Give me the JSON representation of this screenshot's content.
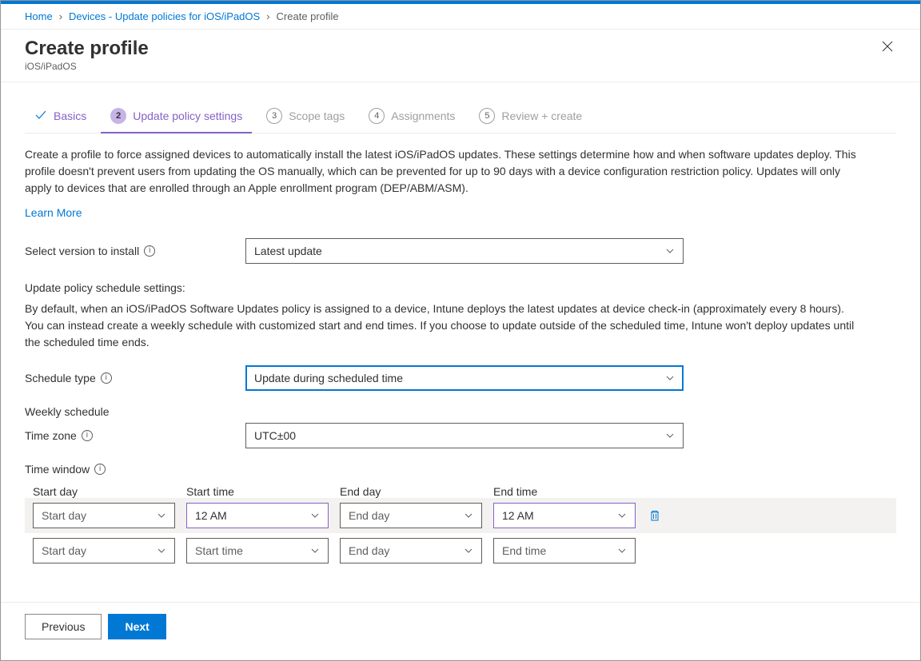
{
  "breadcrumb": {
    "home": "Home",
    "devices": "Devices - Update policies for iOS/iPadOS",
    "current": "Create profile"
  },
  "header": {
    "title": "Create profile",
    "subtitle": "iOS/iPadOS"
  },
  "tabs": {
    "basics": "Basics",
    "update_settings": "Update policy settings",
    "scope_tags": "Scope tags",
    "assignments": "Assignments",
    "review": "Review + create",
    "step2": "2",
    "step3": "3",
    "step4": "4",
    "step5": "5"
  },
  "intro": "Create a profile to force assigned devices to automatically install the latest iOS/iPadOS updates. These settings determine how and when software updates deploy. This profile doesn't prevent users from updating the OS manually, which can be prevented for up to 90 days with a device configuration restriction policy. Updates will only apply to devices that are enrolled through an Apple enrollment program (DEP/ABM/ASM).",
  "learn_more": "Learn More",
  "fields": {
    "select_version_label": "Select version to install",
    "select_version_value": "Latest update",
    "schedule_heading": "Update policy schedule settings:",
    "schedule_para": "By default, when an iOS/iPadOS Software Updates policy is assigned to a device, Intune deploys the latest updates at device check-in (approximately every 8 hours). You can instead create a weekly schedule with customized start and end times. If you choose to update outside of the scheduled time, Intune won't deploy updates until the scheduled time ends.",
    "schedule_type_label": "Schedule type",
    "schedule_type_value": "Update during scheduled time",
    "weekly_schedule": "Weekly schedule",
    "time_zone_label": "Time zone",
    "time_zone_value": "UTC±00",
    "time_window_label": "Time window"
  },
  "time_window": {
    "headers": {
      "start_day": "Start day",
      "start_time": "Start time",
      "end_day": "End day",
      "end_time": "End time"
    },
    "rows": [
      {
        "start_day_ph": "Start day",
        "start_time": "12 AM",
        "end_day_ph": "End day",
        "end_time": "12 AM",
        "has_delete": true
      },
      {
        "start_day_ph": "Start day",
        "start_time_ph": "Start time",
        "end_day_ph": "End day",
        "end_time_ph": "End time",
        "has_delete": false
      }
    ]
  },
  "footer": {
    "previous": "Previous",
    "next": "Next"
  },
  "info_char": "i"
}
